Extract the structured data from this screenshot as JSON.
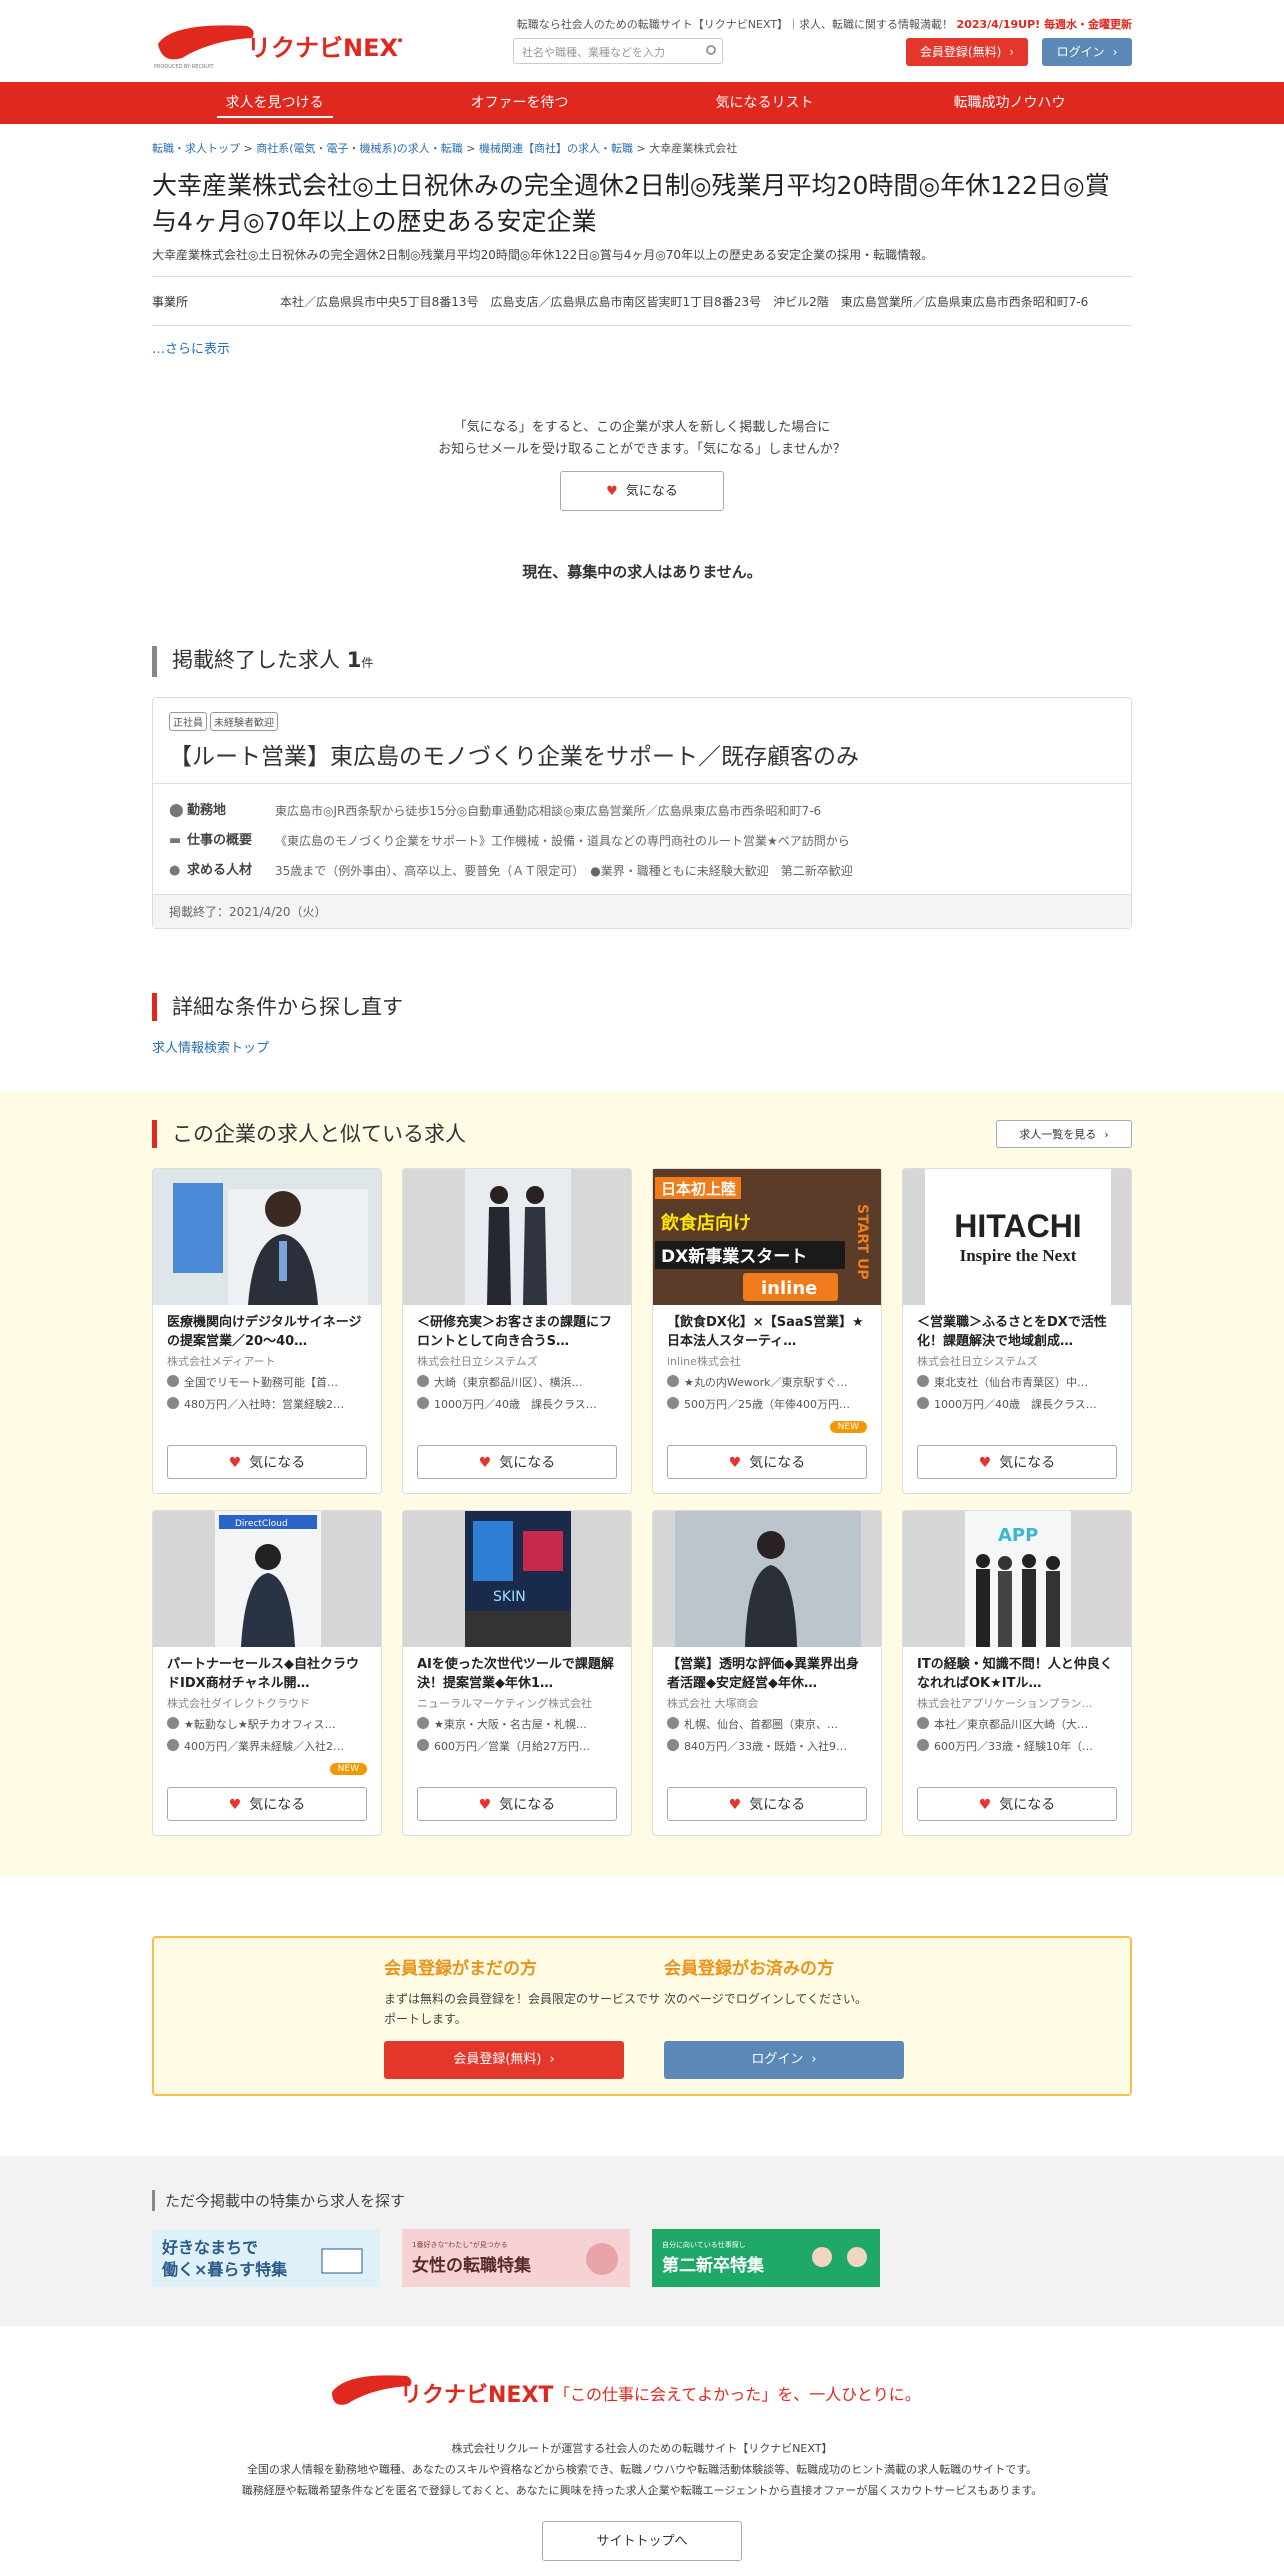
{
  "header": {
    "tagline": "転職なら社会人のための転職サイト【リクナビNEXT】｜求人、転職に関する情報満載！",
    "update": "2023/4/19UP! 毎週水・金曜更新",
    "search_placeholder": "社名や職種、業種などを入力",
    "register_btn": "会員登録(無料)",
    "login_btn": "ログイン",
    "logo_text": "リクナビNEXT",
    "logo_sub": "PRODUCED BY RECRUIT"
  },
  "nav": [
    "求人を見つける",
    "オファーを待つ",
    "気になるリスト",
    "転職成功ノウハウ"
  ],
  "breadcrumb": {
    "links": [
      "転職・求人トップ",
      "商社系(電気・電子・機械系)の求人・転職",
      "機械関連【商社】の求人・転職"
    ],
    "current": "大幸産業株式会社"
  },
  "company": {
    "title": "大幸産業株式会社◎土日祝休みの完全週休2日制◎残業月平均20時間◎年休122日◎賞与4ヶ月◎70年以上の歴史ある安定企業",
    "subtitle": "大幸産業株式会社◎土日祝休みの完全週休2日制◎残業月平均20時間◎年休122日◎賞与4ヶ月◎70年以上の歴史ある安定企業の採用・転職情報。",
    "office_label": "事業所",
    "office_value": "本社／広島県呉市中央5丁目8番13号　広島支店／広島県広島市南区皆実町1丁目8番23号　沖ビル2階　東広島営業所／広島県東広島市西条昭和町7-6",
    "more": "…さらに表示"
  },
  "kininaru": {
    "line1": "「気になる」をすると、この企業が求人を新しく掲載した場合に",
    "line2": "お知らせメールを受け取ることができます。「気になる」しませんか？",
    "button": "気になる"
  },
  "no_jobs": "現在、募集中の求人はありません。",
  "ended": {
    "title": "掲載終了した求人",
    "count": "1",
    "count_unit": "件",
    "tags": [
      "正社員",
      "未経験者歓迎"
    ],
    "job_title": "【ルート営業】東広島のモノづくり企業をサポート／既存顧客のみ",
    "rows": [
      {
        "label": "勤務地",
        "value": "東広島市◎JR西条駅から徒歩15分◎自動車通勤応相談◎東広島営業所／広島県東広島市西条昭和町7-6"
      },
      {
        "label": "仕事の概要",
        "value": "《東広島のモノづくり企業をサポート》工作機械・設備・道具などの専門商社のルート営業★ペア訪問から"
      },
      {
        "label": "求める人材",
        "value": "35歳まで（例外事由）、高卒以上、要普免（ＡＴ限定可）　●業界・職種ともに未経験大歓迎　第二新卒歓迎"
      }
    ],
    "end_date": "掲載終了：2021/4/20（火）"
  },
  "retry": {
    "title": "詳細な条件から探し直す",
    "link": "求人情報検索トップ"
  },
  "similar": {
    "title": "この企業の求人と似ている求人",
    "list_btn": "求人一覧を見る",
    "cards": [
      {
        "title": "医療機関向けデジタルサイネージの提案営業／20～40…",
        "company": "株式会社メディアート",
        "place": "全国でリモート勤務可能【首…",
        "salary": "480万円／入社時：営業経験2…",
        "new": "",
        "btn": "気になる"
      },
      {
        "title": "＜研修充実＞お客さまの課題にフロントとして向き合うS…",
        "company": "株式会社日立システムズ",
        "place": "大崎（東京都品川区）、横浜…",
        "salary": "1000万円／40歳　課長クラス…",
        "new": "",
        "btn": "気になる"
      },
      {
        "title": "【飲食DX化】×【SaaS営業】★日本法人スターティ…",
        "company": "inline株式会社",
        "place": "★丸の内Wework／東京駅すぐ…",
        "salary": "500万円／25歳（年俸400万円…",
        "new": "NEW",
        "btn": "気になる"
      },
      {
        "title": "＜営業職＞ふるさとをDXで活性化！課題解決で地域創成…",
        "company": "株式会社日立システムズ",
        "place": "東北支社（仙台市青葉区）中…",
        "salary": "1000万円／40歳　課長クラス…",
        "new": "",
        "btn": "気になる"
      },
      {
        "title": "パートナーセールス◆自社クラウドIDX商材チャネル開…",
        "company": "株式会社ダイレクトクラウド",
        "place": "★転勤なし★駅チカオフィス…",
        "salary": "400万円／業界未経験／入社2…",
        "new": "NEW",
        "btn": "気になる"
      },
      {
        "title": "AIを使った次世代ツールで課題解決！提案営業◆年休1…",
        "company": "ニューラルマーケティング株式会社",
        "place": "★東京・大阪・名古屋・札幌…",
        "salary": "600万円／営業（月給27万円…",
        "new": "",
        "btn": "気になる"
      },
      {
        "title": "【営業】透明な評価◆異業界出身者活躍◆安定経営◆年休…",
        "company": "株式会社 大塚商会",
        "place": "札幌、仙台、首都圏（東京、…",
        "salary": "840万円／33歳・既婚・入社9…",
        "new": "",
        "btn": "気になる"
      },
      {
        "title": "ITの経験・知識不問！人と仲良くなれればOK★ITル…",
        "company": "株式会社アプリケーションプラン…",
        "place": "本社／東京都品川区大崎（大…",
        "salary": "600万円／33歳・経験10年（…",
        "new": "",
        "btn": "気になる"
      }
    ],
    "image_text": {
      "c3_top": "日本初上陸",
      "c3_mid": "飲食店向け",
      "c3_bottom": "DX新事業スタート",
      "c3_brand": "inline",
      "c3_side": "START UP",
      "c4_logo": "HITACHI",
      "c4_slogan": "Inspire the Next",
      "c5_sign": "DirectCloud",
      "c6_sign": "SKIN",
      "c8_sign": "APP"
    }
  },
  "membership": {
    "not_member_title": "会員登録がまだの方",
    "not_member_text": "まずは無料の会員登録を！会員限定のサービスでサポートします。",
    "not_member_btn": "会員登録(無料)",
    "member_title": "会員登録がお済みの方",
    "member_text": "次のページでログインしてください。",
    "member_btn": "ログイン"
  },
  "features": {
    "title": "ただ今掲載中の特集から求人を探す",
    "banners": [
      {
        "line1": "好きなまちで",
        "line2": "働く×暮らす特集"
      },
      {
        "line1": "1番好きな“わたし”が見つかる",
        "line2": "女性の転職特集"
      },
      {
        "line1": "自分に向いている仕事探し",
        "line2": "第二新卒特集"
      }
    ]
  },
  "footer": {
    "catch": "「この仕事に会えてよかった」を、一人ひとりに。",
    "desc1": "株式会社リクルートが運営する社会人のための転職サイト【リクナビNEXT】",
    "desc2": "全国の求人情報を勤務地や職種、あなたのスキルや資格などから検索でき、転職ノウハウや転職活動体験談等、転職成功のヒント満載の求人転職のサイトです。",
    "desc3": "職務経歴や転職希望条件などを匿名で登録しておくと、あなたに興味を持った求人企業や転職エージェントから直接オファーが届くスカウトサービスもあります。",
    "top_btn": "サイトトップへ"
  }
}
